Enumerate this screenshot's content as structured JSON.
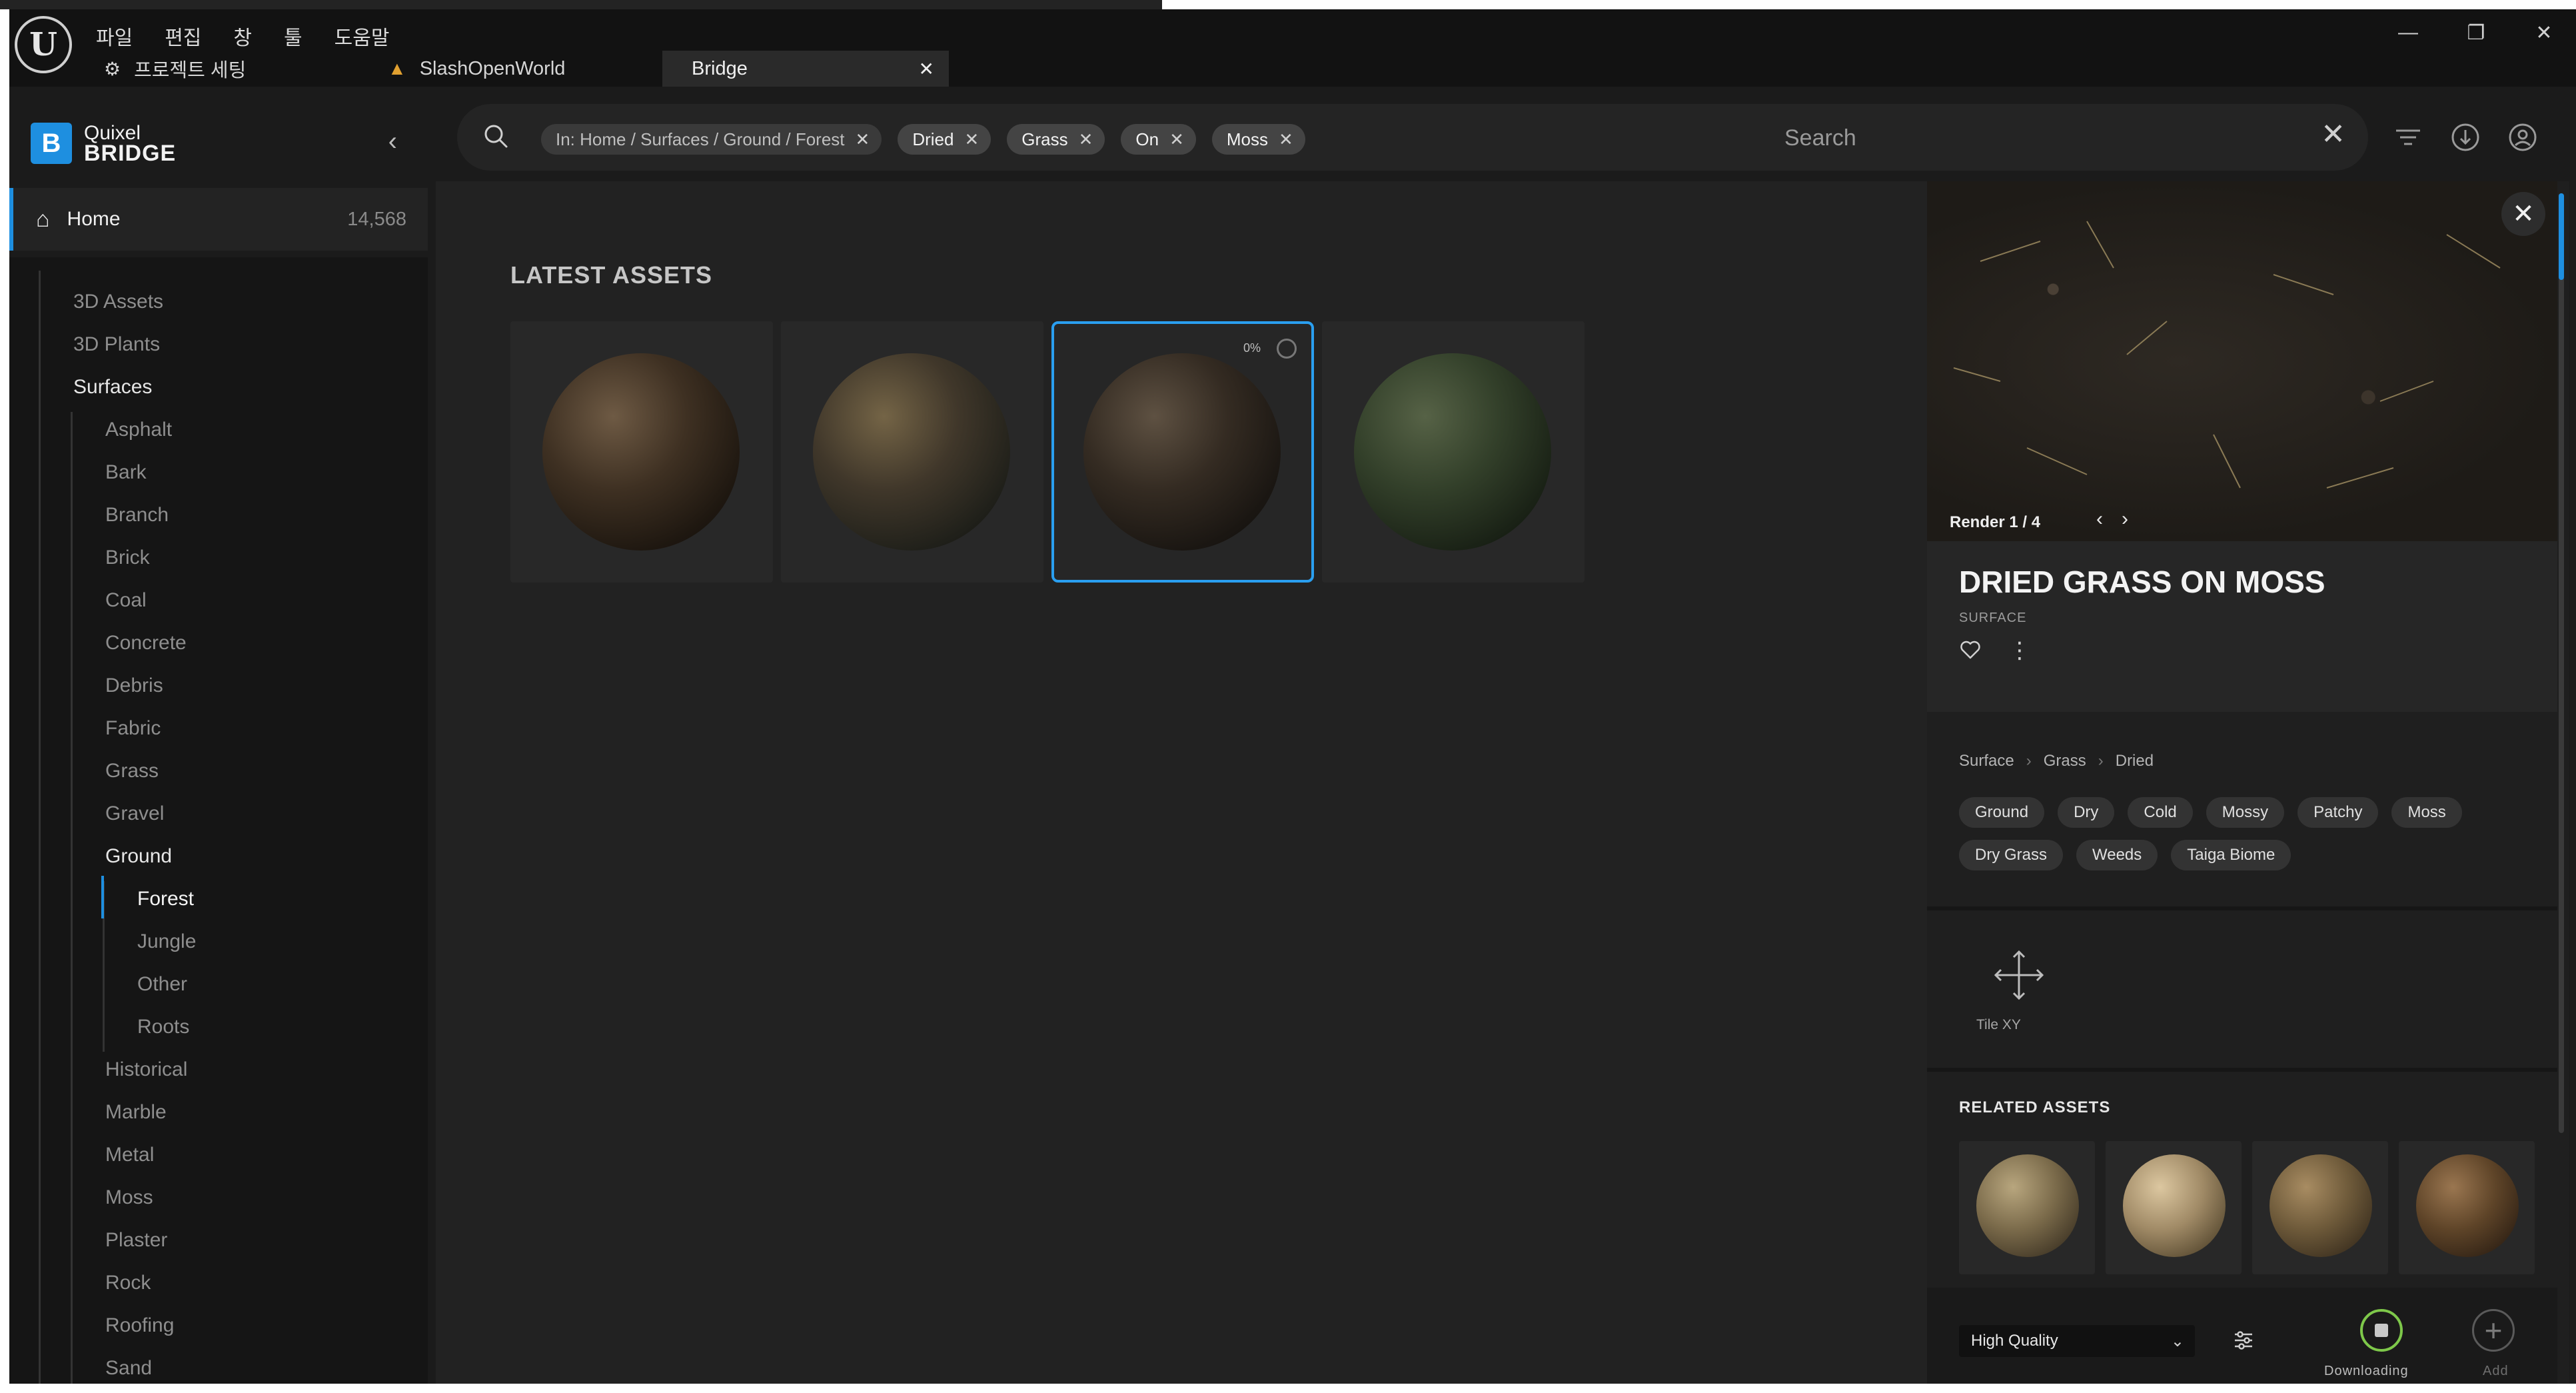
{
  "menu": [
    "파일",
    "편집",
    "창",
    "툴",
    "도움말"
  ],
  "tabs": [
    {
      "label": "프로젝트 세팅"
    },
    {
      "label": "SlashOpenWorld"
    },
    {
      "label": "Bridge"
    }
  ],
  "brand": {
    "line1": "Quixel",
    "line2": "BRIDGE"
  },
  "home": {
    "label": "Home",
    "count": "14,568"
  },
  "categories": {
    "top": [
      "3D Assets",
      "3D Plants",
      "Surfaces"
    ],
    "surfaces": [
      "Asphalt",
      "Bark",
      "Branch",
      "Brick",
      "Coal",
      "Concrete",
      "Debris",
      "Fabric",
      "Grass",
      "Gravel",
      "Ground"
    ],
    "ground": [
      "Forest",
      "Jungle",
      "Other",
      "Roots"
    ],
    "surfaces_after": [
      "Historical",
      "Marble",
      "Metal",
      "Moss",
      "Plaster",
      "Rock",
      "Roofing",
      "Sand"
    ]
  },
  "search": {
    "path_chip": "In: Home / Surfaces / Ground / Forest",
    "terms": [
      "Dried",
      "Grass",
      "On",
      "Moss"
    ],
    "placeholder": "Search"
  },
  "content": {
    "section_title": "LATEST ASSETS",
    "download_progress": "0%"
  },
  "detail": {
    "render_label": "Render 1 / 4",
    "title": "DRIED GRASS ON MOSS",
    "type": "SURFACE",
    "breadcrumb": [
      "Surface",
      "Grass",
      "Dried"
    ],
    "tags": [
      "Ground",
      "Dry",
      "Cold",
      "Mossy",
      "Patchy",
      "Moss",
      "Dry Grass",
      "Weeds",
      "Taiga Biome"
    ],
    "tile_label": "Tile XY",
    "related_title": "RELATED ASSETS",
    "quality": "High Quality",
    "downloading_label": "Downloading",
    "add_label": "Add"
  },
  "colors": {
    "accent": "#1e8fe0",
    "selection": "#2a9ff0",
    "download_ring": "#7ec84a"
  }
}
